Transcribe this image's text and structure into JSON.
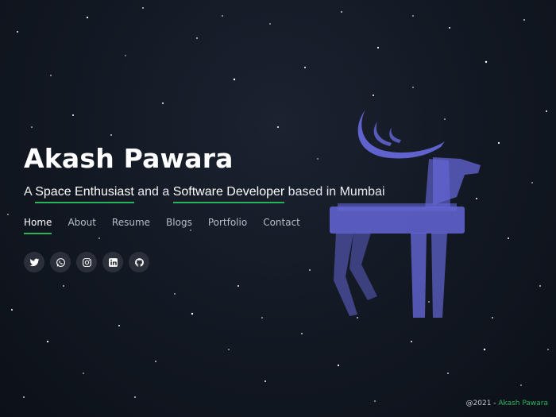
{
  "hero": {
    "name": "Akash Pawara",
    "tagline": {
      "prefix": "A ",
      "highlight1": "Space Enthusiast",
      "middle": " and a ",
      "highlight2": "Software Developer",
      "suffix": " based in Mumbai"
    }
  },
  "nav": {
    "home": "Home",
    "about": "About",
    "resume": "Resume",
    "blogs": "Blogs",
    "portfolio": "Portfolio",
    "contact": "Contact"
  },
  "social": [
    "twitter-icon",
    "whatsapp-icon",
    "instagram-icon",
    "linkedin-icon",
    "github-icon"
  ],
  "footer": {
    "prefix": "@2021 - ",
    "author": "Akash Pawara"
  },
  "colors": {
    "accent": "#2bb35b",
    "background": "#121822",
    "deer": "#6466d6",
    "icon_bg": "#2a2f39"
  }
}
